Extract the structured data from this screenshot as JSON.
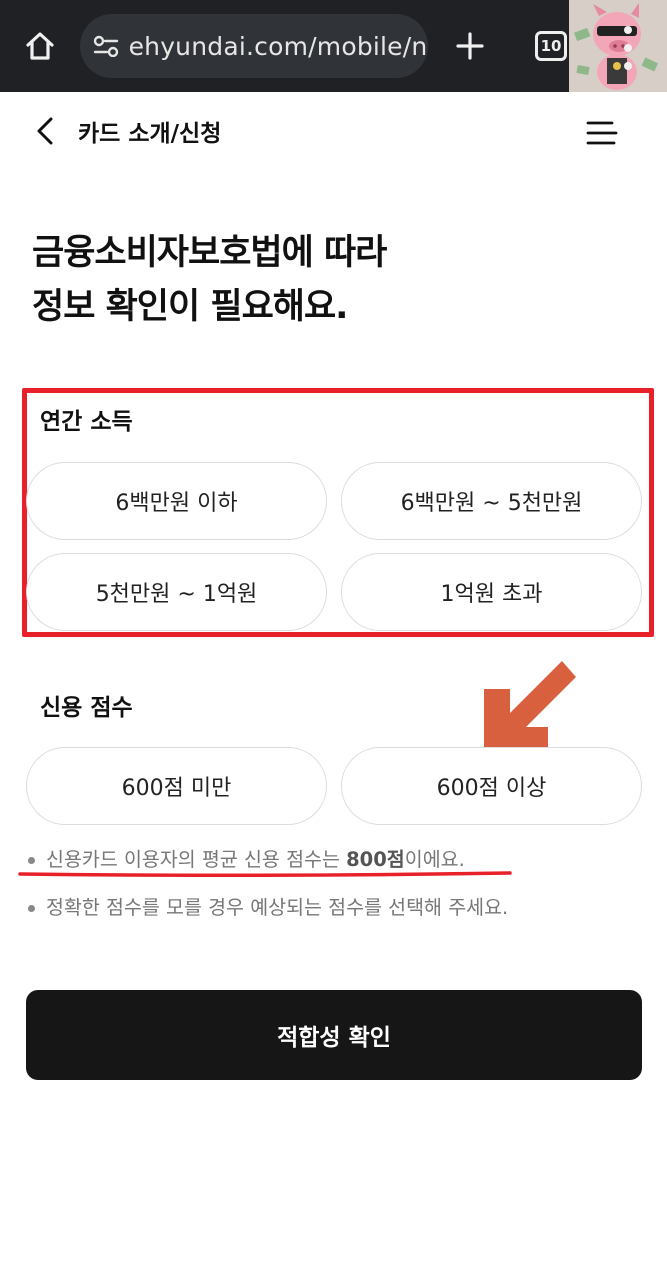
{
  "browser": {
    "url": "ehyundai.com/mobile/ne",
    "tab_count": "10",
    "colors": {
      "bar": "#1f2125",
      "url_box": "#303338"
    }
  },
  "header": {
    "title": "카드 소개/신청"
  },
  "heading": {
    "line1": "금융소비자보호법에 따라",
    "line2": "정보 확인이 필요해요."
  },
  "income": {
    "label": "연간 소득",
    "options": [
      "6백만원 이하",
      "6백만원 ~ 5천만원",
      "5천만원 ~ 1억원",
      "1억원 초과"
    ]
  },
  "credit": {
    "label": "신용 점수",
    "options": [
      "600점 미만",
      "600점 이상"
    ]
  },
  "notes": {
    "note1_pre": "신용카드 이용자의 평균 신용 점수는 ",
    "note1_bold": "800점",
    "note1_post": "이에요.",
    "note2": "정확한 점수를 모를 경우 예상되는 점수를 선택해 주세요."
  },
  "confirm_button": "적합성 확인",
  "annotation_colors": {
    "box": "#e8202a",
    "arrow": "#d9603f"
  }
}
